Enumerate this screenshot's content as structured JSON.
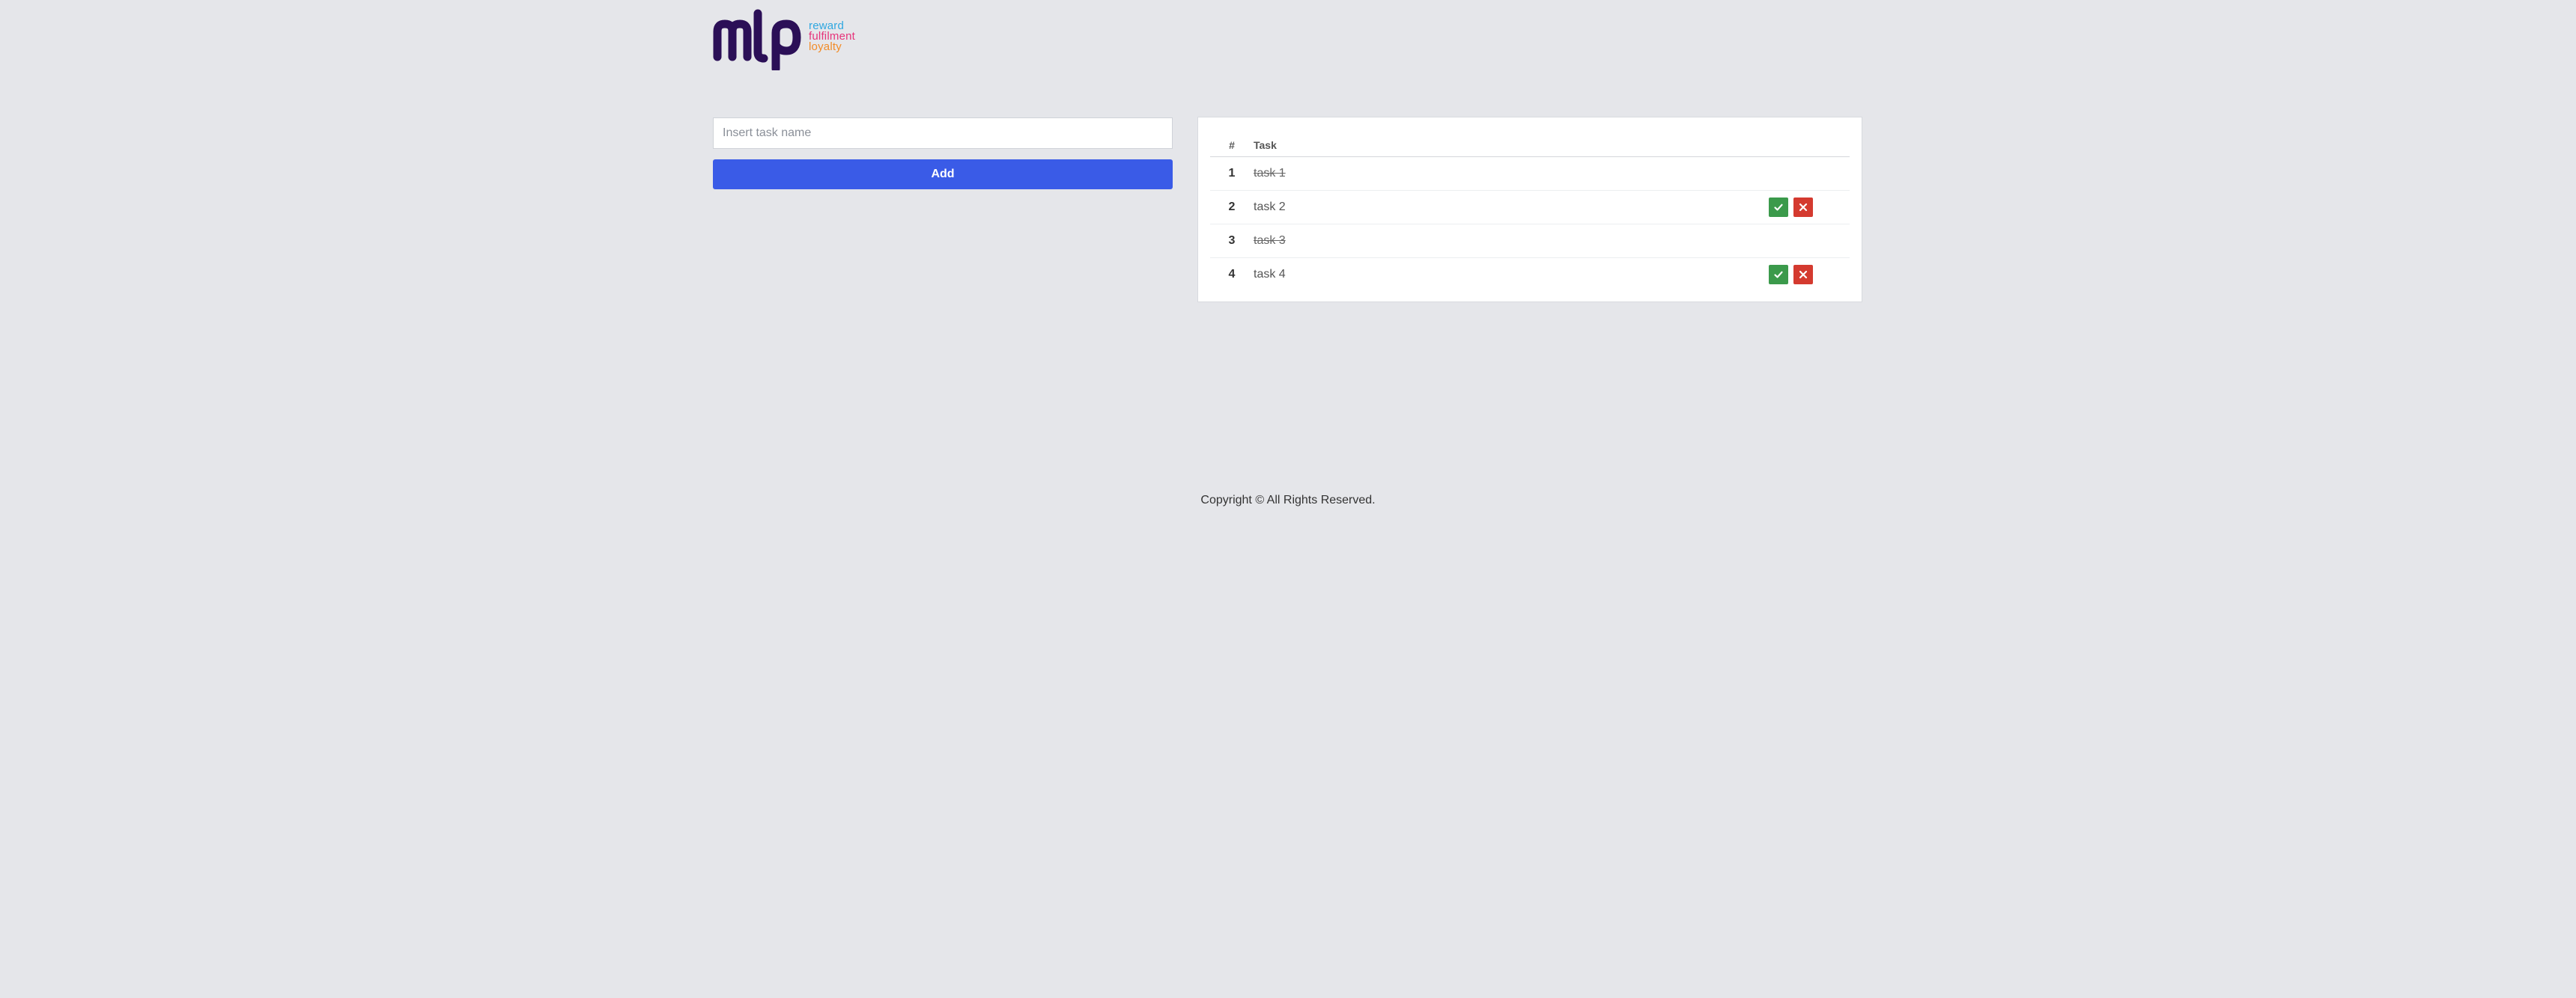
{
  "logo": {
    "brand": "mlp",
    "lines": [
      "reward",
      "fulfilment",
      "loyalty"
    ],
    "colors": {
      "mark": "#2b0f57",
      "reward": "#2ea7e0",
      "fulfilment": "#e6347a",
      "loyalty": "#f28c28"
    }
  },
  "form": {
    "input_placeholder": "Insert task name",
    "input_value": "",
    "add_label": "Add"
  },
  "table": {
    "headers": {
      "num": "#",
      "task": "Task"
    },
    "rows": [
      {
        "num": "1",
        "task": "task 1",
        "completed": true
      },
      {
        "num": "2",
        "task": "task 2",
        "completed": false,
        "actions": [
          "check-icon",
          "close-icon"
        ]
      },
      {
        "num": "3",
        "task": "task 3",
        "completed": true
      },
      {
        "num": "4",
        "task": "task 4",
        "completed": false,
        "actions": [
          "check-icon",
          "close-icon"
        ]
      }
    ]
  },
  "footer": {
    "copyright": "Copyright © All Rights Reserved."
  },
  "colors": {
    "accent": "#3a5be7",
    "success": "#3b9a4b",
    "danger": "#d43a2f",
    "background": "#e5e6ea"
  }
}
